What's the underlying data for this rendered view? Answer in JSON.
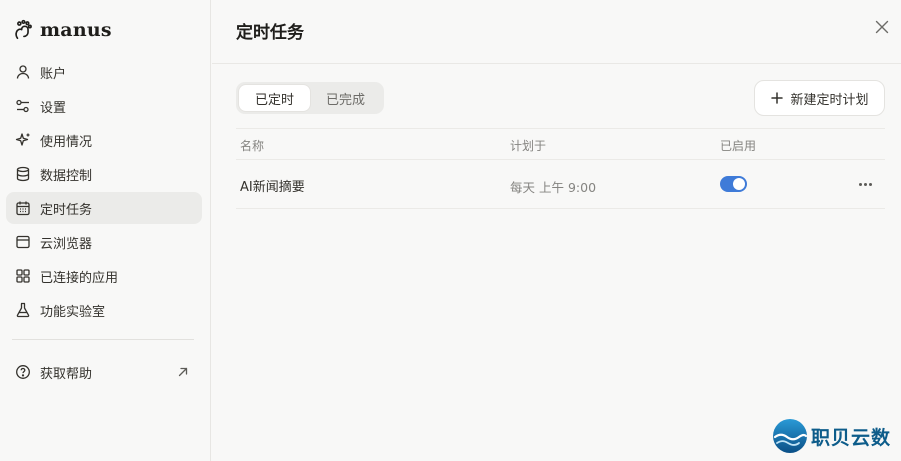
{
  "brand": {
    "name": "manus"
  },
  "sidebar": {
    "items": [
      {
        "label": "账户",
        "icon": "user-icon"
      },
      {
        "label": "设置",
        "icon": "sliders-icon"
      },
      {
        "label": "使用情况",
        "icon": "sparkle-icon"
      },
      {
        "label": "数据控制",
        "icon": "database-icon"
      },
      {
        "label": "定时任务",
        "icon": "calendar-icon",
        "active": true
      },
      {
        "label": "云浏览器",
        "icon": "browser-window-icon"
      },
      {
        "label": "已连接的应用",
        "icon": "apps-grid-icon"
      },
      {
        "label": "功能实验室",
        "icon": "flask-icon"
      }
    ],
    "help": {
      "label": "获取帮助",
      "icon": "question-circle-icon"
    }
  },
  "main": {
    "title": "定时任务",
    "tabs": [
      {
        "label": "已定时",
        "active": true
      },
      {
        "label": "已完成",
        "active": false
      }
    ],
    "new_button": "新建定时计划",
    "table": {
      "headers": {
        "name": "名称",
        "plan": "计划于",
        "enabled": "已启用"
      },
      "rows": [
        {
          "name": "AI新闻摘要",
          "plan": "每天 上午 9:00",
          "enabled": true
        }
      ]
    }
  },
  "watermark": {
    "text": "职贝云数"
  },
  "colors": {
    "accent": "#3f7bd8",
    "active_bg": "#ebebe9",
    "watermark": "#0d5c8a"
  }
}
